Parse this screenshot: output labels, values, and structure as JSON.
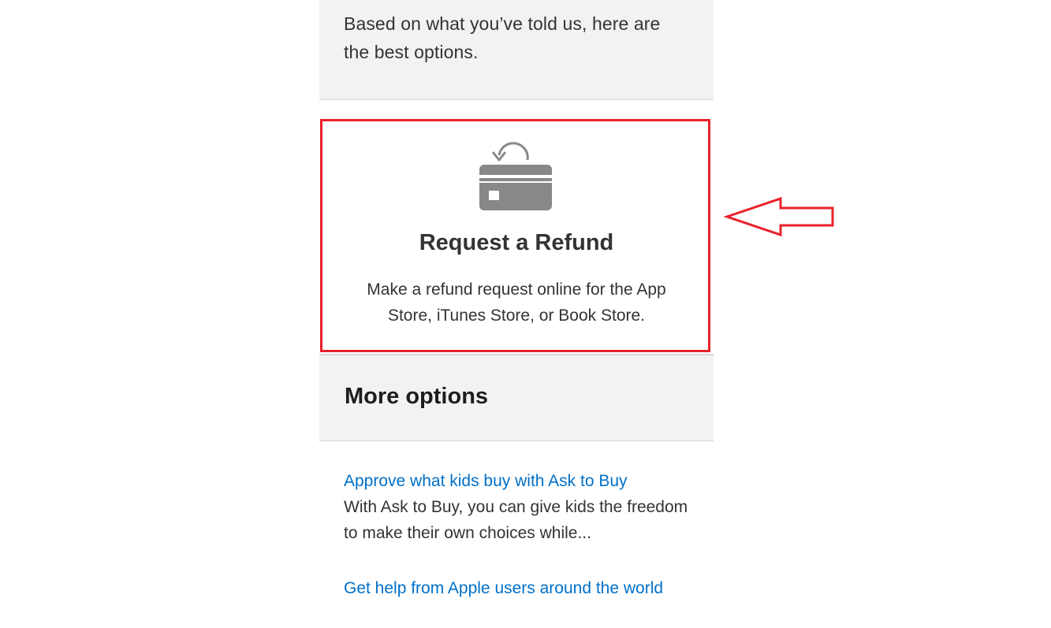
{
  "intro": {
    "text": "Based on what you’ve told us, here are the best options."
  },
  "refund_card": {
    "icon": "refund-card-icon",
    "title": "Request a Refund",
    "description": "Make a refund request online for the App Store, iTunes Store, or Book Store."
  },
  "more_options": {
    "title": "More options",
    "items": [
      {
        "link": "Approve what kids buy with Ask to Buy",
        "description": "With Ask to Buy, you can give kids the freedom to make their own choices while..."
      },
      {
        "link": "Get help from Apple users around the world",
        "description": ""
      }
    ]
  },
  "annotation": {
    "highlight_color": "#e8212b",
    "arrow_direction": "left"
  },
  "colors": {
    "link": "#0070c9",
    "section_bg": "#f2f2f2",
    "text": "#333333",
    "icon": "#888888"
  }
}
